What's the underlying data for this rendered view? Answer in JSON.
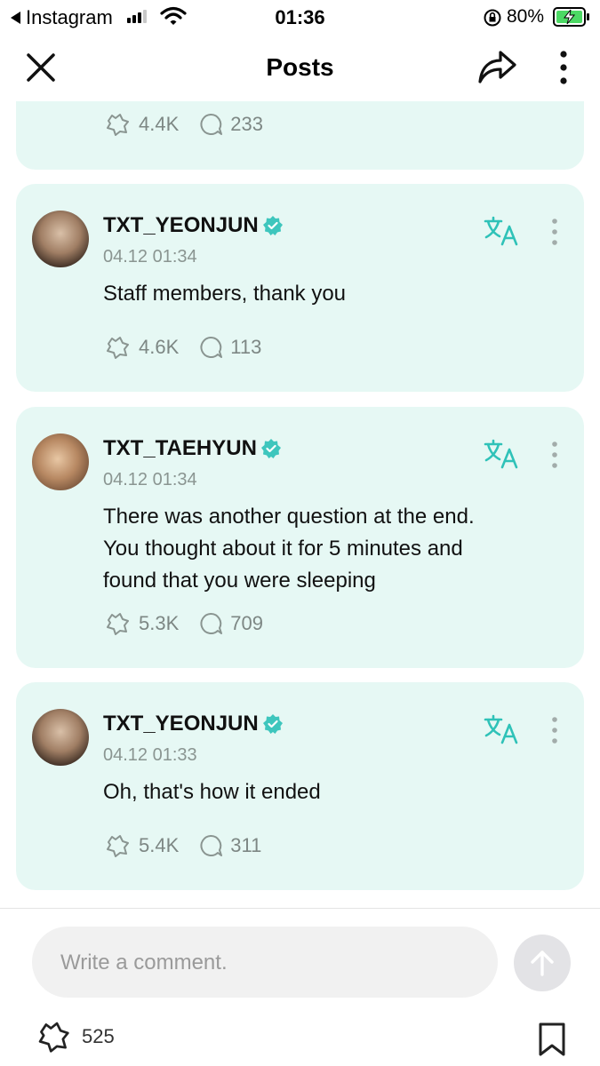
{
  "status_bar": {
    "back_app": "Instagram",
    "time": "01:36",
    "battery_pct": "80%"
  },
  "header": {
    "title": "Posts"
  },
  "posts": [
    {
      "likes": "4.4K",
      "comments": "233"
    },
    {
      "username": "TXT_YEONJUN",
      "date": "04.12 01:34",
      "text": "Staff members, thank you",
      "likes": "4.6K",
      "comments": "113"
    },
    {
      "username": "TXT_TAEHYUN",
      "date": "04.12 01:34",
      "text_lines": [
        "There was another question at the end.",
        "You thought about it for 5 minutes and",
        "found that you were sleeping"
      ],
      "likes": "5.3K",
      "comments": "709"
    },
    {
      "username": "TXT_YEONJUN",
      "date": "04.12 01:33",
      "text": "Oh, that's how it ended",
      "likes": "5.4K",
      "comments": "311"
    }
  ],
  "composer": {
    "placeholder": "Write a comment."
  },
  "footer": {
    "like_count": "525"
  },
  "colors": {
    "card_bg": "#e6f8f4",
    "accent": "#2fc2b8",
    "verified": "#3ec6bd",
    "muted_text": "#8a9591"
  }
}
